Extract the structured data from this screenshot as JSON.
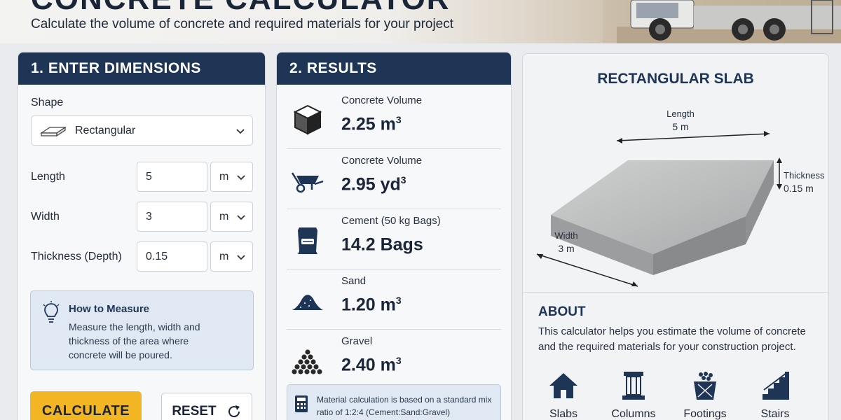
{
  "header": {
    "title": "CONCRETE CALCULATOR",
    "subtitle": "Calculate the volume of concrete and required materials for your project"
  },
  "dimensions": {
    "heading": "1. ENTER DIMENSIONS",
    "shape_label": "Shape",
    "shape_value": "Rectangular",
    "fields": [
      {
        "label": "Length",
        "value": "5",
        "unit": "m"
      },
      {
        "label": "Width",
        "value": "3",
        "unit": "m"
      },
      {
        "label": "Thickness (Depth)",
        "value": "0.15",
        "unit": "m"
      }
    ],
    "tip": {
      "title": "How to Measure",
      "text": "Measure the length, width and thickness of the area where concrete will be poured."
    },
    "calculate_label": "CALCULATE",
    "reset_label": "RESET"
  },
  "results": {
    "heading": "2. RESULTS",
    "items": [
      {
        "icon": "cube-icon",
        "label": "Concrete Volume",
        "value": "2.25 m",
        "sup": "3"
      },
      {
        "icon": "wheelbarrow-icon",
        "label": "Concrete Volume",
        "value": "2.95 yd",
        "sup": "3"
      },
      {
        "icon": "cement-bag-icon",
        "label": "Cement (50 kg Bags)",
        "value": "14.2 Bags",
        "sup": ""
      },
      {
        "icon": "sand-pile-icon",
        "label": "Sand",
        "value": "1.20 m",
        "sup": "3"
      },
      {
        "icon": "gravel-pile-icon",
        "label": "Gravel",
        "value": "2.40 m",
        "sup": "3"
      }
    ],
    "note": "Material calculation is based on a standard mix ratio of 1:2:4 (Cement:Sand:Gravel)"
  },
  "preview": {
    "title": "RECTANGULAR SLAB",
    "length_label": "Length",
    "length_value": "5 m",
    "thickness_label": "Thickness",
    "thickness_value": "0.15 m",
    "width_label": "Width",
    "width_value": "3 m"
  },
  "about": {
    "title": "ABOUT",
    "text": "This calculator helps you estimate the volume of concrete and the required materials for your construction project.",
    "categories": [
      {
        "icon": "house-icon",
        "label": "Slabs"
      },
      {
        "icon": "column-icon",
        "label": "Columns"
      },
      {
        "icon": "footing-icon",
        "label": "Footings"
      },
      {
        "icon": "stairs-icon",
        "label": "Stairs"
      }
    ]
  },
  "colors": {
    "navy": "#1f3556",
    "accent_yellow": "#f2b524",
    "tip_bg": "#dfe8f3"
  }
}
